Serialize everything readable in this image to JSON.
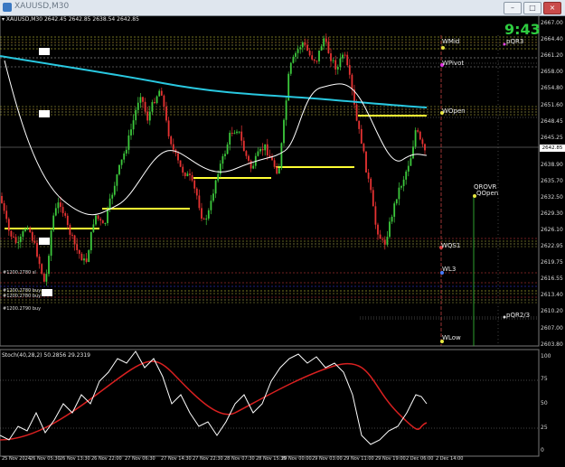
{
  "window": {
    "title": "XAUUSD,M30",
    "buttons": [
      "–",
      "□",
      "×"
    ]
  },
  "chart": {
    "ohlc_header": "▾ XAUUSD,M30  2642.45 2642.85 2638.54 2642.85",
    "clock": "9:43",
    "current_price": "2642.85",
    "price_axis": [
      "2667.00",
      "2664.40",
      "2661.20",
      "2658.00",
      "2654.80",
      "2651.60",
      "2648.45",
      "2645.25",
      "2642.85",
      "2638.90",
      "2635.70",
      "2632.50",
      "2629.30",
      "2626.10",
      "2622.95",
      "2619.75",
      "2616.55",
      "2613.40",
      "2610.20",
      "2607.00",
      "2603.80"
    ],
    "levels": {
      "wmid": "WMid",
      "pqr3": "pQR3",
      "wpivot": "WPivot",
      "wopen": "WOpen",
      "qrovr": "QROVR",
      "qopen": "QOpen",
      "wqs1": "WQS1",
      "wl3": "WL3",
      "pqr23": "pQR2/3",
      "wlow": "WLow"
    },
    "orders": [
      "#1200.2780 sl",
      "#1200.2780 buy",
      "#1200.2780 buy",
      "#1200.2790 buy"
    ],
    "colors": {
      "bull": "#3cc93c",
      "bear": "#e63232",
      "ma_slow": "#29c8e0",
      "ma_fast": "#ffffff",
      "pivot": "#ffff33",
      "stoch_main": "#ffffff",
      "stoch_signal": "#d92020"
    }
  },
  "stoch": {
    "title": "Stoch(40,28,2) 50.2856 29.2319",
    "axis": [
      "100",
      "75",
      "50",
      "25",
      "0"
    ]
  },
  "time_axis": [
    "25 Nov 2024",
    "26 Nov 05:30",
    "26 Nov 13:30",
    "26 Nov 22:00",
    "27 Nov 06:30",
    "27 Nov 14:30",
    "27 Nov 22:30",
    "28 Nov 07:30",
    "28 Nov 15:30",
    "29 Nov 00:00",
    "29 Nov 03:00",
    "29 Nov 11:00",
    "29 Nov 19:00",
    "2 Dec 06:00",
    "2 Dec 14:00"
  ]
}
